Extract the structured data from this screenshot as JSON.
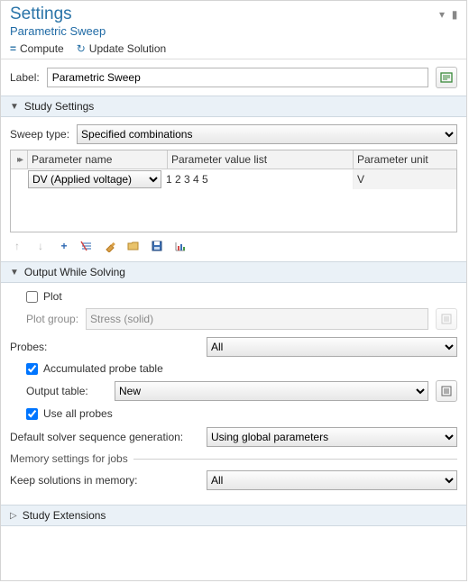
{
  "panel": {
    "title": "Settings",
    "subtitle": "Parametric Sweep"
  },
  "toolbar": {
    "compute": "Compute",
    "update": "Update Solution"
  },
  "label_field": {
    "label": "Label:",
    "value": "Parametric Sweep"
  },
  "sections": {
    "study": {
      "title": "Study Settings",
      "sweep_type_label": "Sweep type:",
      "sweep_type_value": "Specified combinations",
      "table": {
        "col_name": "Parameter name",
        "col_values": "Parameter value list",
        "col_unit": "Parameter unit",
        "row0": {
          "name": "DV (Applied voltage)",
          "values": "1 2 3 4 5",
          "unit": "V"
        }
      }
    },
    "output": {
      "title": "Output While Solving",
      "plot": "Plot",
      "plot_group_label": "Plot group:",
      "plot_group_value": "Stress (solid)",
      "probes_label": "Probes:",
      "probes_value": "All",
      "accum_probe": "Accumulated probe table",
      "output_table_label": "Output table:",
      "output_table_value": "New",
      "use_all_probes": "Use all probes"
    },
    "default_solver_label": "Default solver sequence generation:",
    "default_solver_value": "Using global parameters",
    "memory_header": "Memory settings for jobs",
    "keep_solutions_label": "Keep solutions in memory:",
    "keep_solutions_value": "All",
    "extensions": {
      "title": "Study Extensions"
    }
  },
  "checkboxes": {
    "plot": false,
    "accum_probe": true,
    "use_all_probes": true
  }
}
